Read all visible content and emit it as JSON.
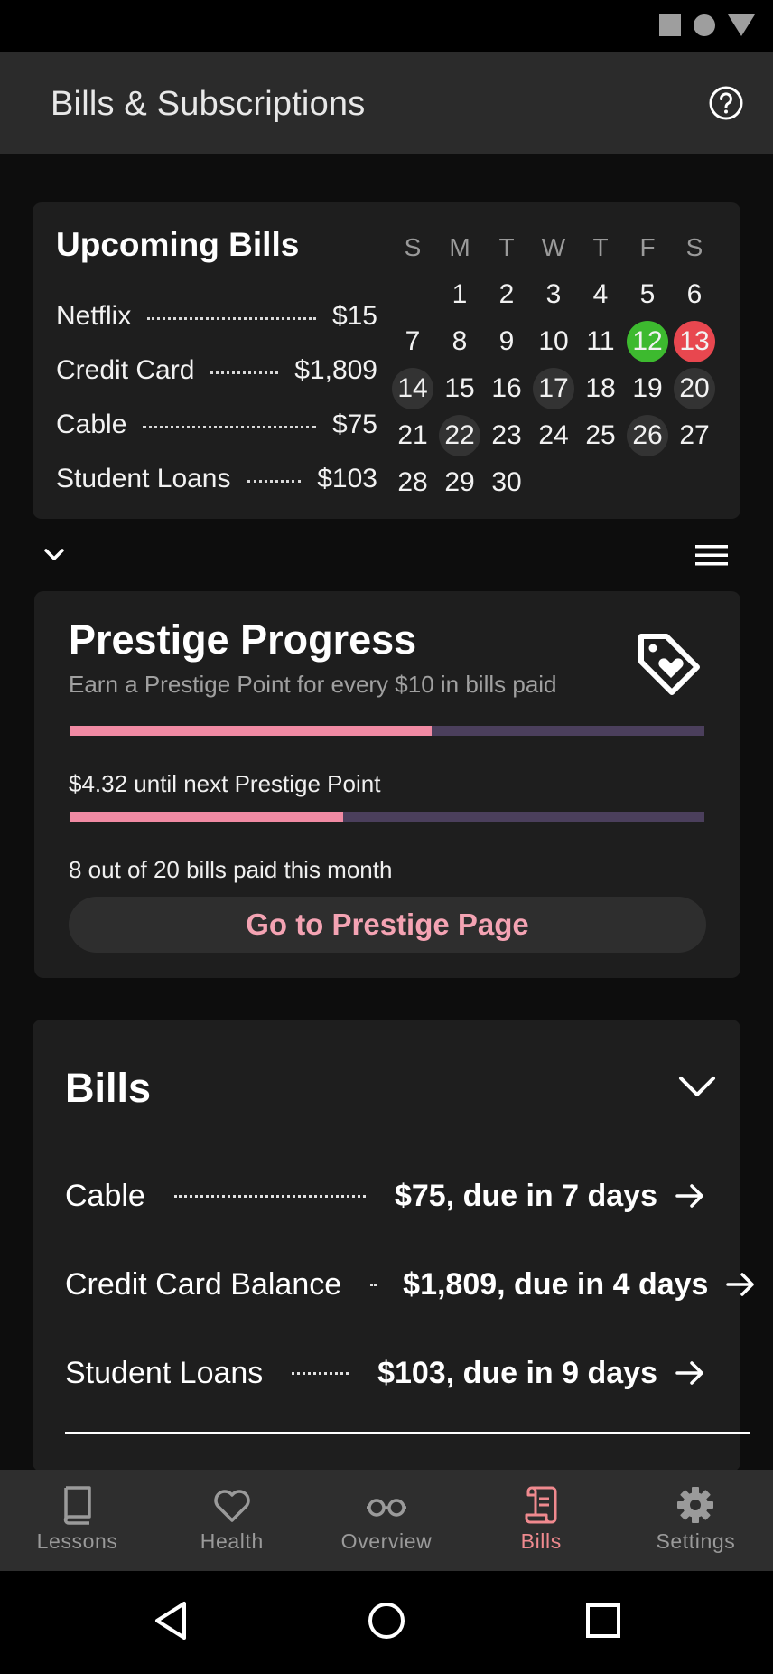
{
  "app": {
    "title": "Bills & Subscriptions"
  },
  "upcoming": {
    "title": "Upcoming Bills",
    "items": [
      {
        "label": "Netflix",
        "amount": "$15"
      },
      {
        "label": "Credit Card",
        "amount": "$1,809"
      },
      {
        "label": "Cable",
        "amount": "$75"
      },
      {
        "label": "Student Loans",
        "amount": "$103"
      }
    ]
  },
  "calendar": {
    "weekdays": [
      "S",
      "M",
      "T",
      "W",
      "T",
      "F",
      "S"
    ],
    "start_offset": 1,
    "days": 30,
    "today": 12,
    "due_soon": 13,
    "marked": [
      14,
      17,
      20,
      22,
      26
    ]
  },
  "prestige": {
    "title": "Prestige Progress",
    "subtitle": "Earn a Prestige Point for every $10 in bills paid",
    "point_progress": 0.57,
    "point_text": "$4.32 until next Prestige Point",
    "bills_progress": 0.43,
    "bills_text": "8 out of 20 bills paid this month",
    "button_label": "Go to Prestige Page"
  },
  "bills": {
    "title": "Bills",
    "items": [
      {
        "label": "Cable",
        "due": "$75, due in 7 days"
      },
      {
        "label": "Credit Card Balance",
        "due": "$1,809, due in 4 days"
      },
      {
        "label": "Student Loans",
        "due": "$103, due in 9 days"
      }
    ]
  },
  "nav": {
    "items": [
      {
        "label": "Lessons",
        "icon": "book-icon"
      },
      {
        "label": "Health",
        "icon": "heart-icon"
      },
      {
        "label": "Overview",
        "icon": "glasses-icon"
      },
      {
        "label": "Bills",
        "icon": "receipt-icon",
        "active": true
      },
      {
        "label": "Settings",
        "icon": "gear-icon"
      }
    ]
  },
  "colors": {
    "accent_pink": "#f08aa3",
    "today_green": "#3dba2f",
    "due_red": "#e8474f",
    "nav_active": "#f08a8f"
  }
}
